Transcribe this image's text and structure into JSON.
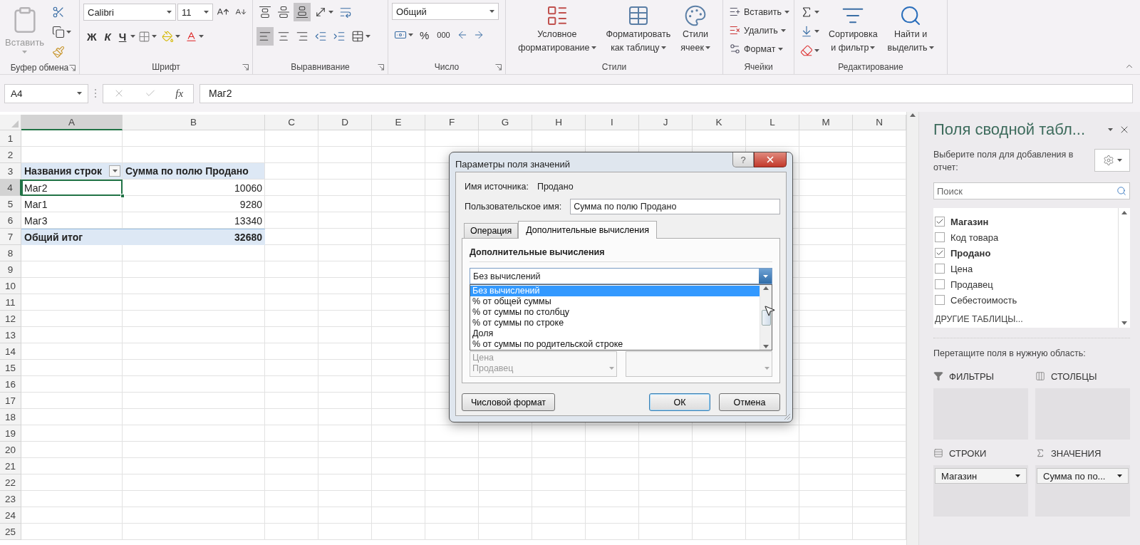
{
  "ribbon": {
    "clipboard": {
      "label": "Буфер обмена",
      "paste": "Вставить"
    },
    "font": {
      "label": "Шрифт",
      "font_name": "Calibri",
      "font_size": "11",
      "bold": "Ж",
      "italic": "К",
      "underline": "Ч"
    },
    "alignment": {
      "label": "Выравнивание",
      "vertical": [
        {
          "selected": false
        },
        {
          "selected": false
        },
        {
          "selected": true
        }
      ],
      "horizontal": [
        {
          "selected": true
        },
        {
          "selected": false
        },
        {
          "selected": false
        }
      ]
    },
    "number": {
      "label": "Число",
      "format": "Общий",
      "percent": "%",
      "thousands": "000"
    },
    "styles": {
      "label": "Стили",
      "buttons": [
        {
          "kind": "conditional",
          "lines": [
            "Условное",
            "форматирование"
          ]
        },
        {
          "kind": "table",
          "lines": [
            "Форматировать",
            "как таблицу"
          ]
        },
        {
          "kind": "cell",
          "lines": [
            "Стили",
            "ячеек"
          ]
        }
      ]
    },
    "cells": {
      "label": "Ячейки",
      "buttons": [
        {
          "kind": "insert",
          "label": "Вставить"
        },
        {
          "kind": "delete",
          "label": "Удалить"
        },
        {
          "kind": "format",
          "label": "Формат"
        }
      ]
    },
    "editing": {
      "label": "Редактирование",
      "buttons": [
        {
          "kind": "sort",
          "lines": [
            "Сортировка",
            "и фильтр"
          ]
        },
        {
          "kind": "find",
          "lines": [
            "Найти и",
            "выделить"
          ]
        }
      ]
    }
  },
  "formula_bar": {
    "name_box": "A4",
    "fx": "fx",
    "value": "Маг2"
  },
  "sheet": {
    "columns": [
      {
        "label": "A",
        "selected": true
      },
      {
        "label": "B",
        "selected": false
      },
      {
        "label": "C",
        "selected": false
      },
      {
        "label": "D",
        "selected": false
      },
      {
        "label": "E",
        "selected": false
      },
      {
        "label": "F",
        "selected": false
      },
      {
        "label": "G",
        "selected": false
      },
      {
        "label": "H",
        "selected": false
      },
      {
        "label": "I",
        "selected": false
      },
      {
        "label": "J",
        "selected": false
      },
      {
        "label": "K",
        "selected": false
      },
      {
        "label": "L",
        "selected": false
      },
      {
        "label": "M",
        "selected": false
      },
      {
        "label": "N",
        "selected": false
      }
    ],
    "rows": [
      {
        "label": "1",
        "selected": false
      },
      {
        "label": "2",
        "selected": false
      },
      {
        "label": "3",
        "selected": false
      },
      {
        "label": "4",
        "selected": true
      },
      {
        "label": "5",
        "selected": false
      },
      {
        "label": "6",
        "selected": false
      },
      {
        "label": "7",
        "selected": false
      },
      {
        "label": "8",
        "selected": false
      },
      {
        "label": "9",
        "selected": false
      },
      {
        "label": "10",
        "selected": false
      },
      {
        "label": "11",
        "selected": false
      },
      {
        "label": "12",
        "selected": false
      },
      {
        "label": "13",
        "selected": false
      },
      {
        "label": "14",
        "selected": false
      },
      {
        "label": "15",
        "selected": false
      },
      {
        "label": "16",
        "selected": false
      },
      {
        "label": "17",
        "selected": false
      },
      {
        "label": "18",
        "selected": false
      },
      {
        "label": "19",
        "selected": false
      },
      {
        "label": "20",
        "selected": false
      },
      {
        "label": "21",
        "selected": false
      },
      {
        "label": "22",
        "selected": false
      },
      {
        "label": "23",
        "selected": false
      },
      {
        "label": "24",
        "selected": false
      },
      {
        "label": "25",
        "selected": false
      }
    ],
    "pivot": {
      "headers": [
        "Названия строк",
        "Сумма по полю Продано"
      ],
      "rows": [
        {
          "label": "Маг2",
          "value": "10060",
          "selected": true
        },
        {
          "label": "Маг1",
          "value": "9280",
          "selected": false
        },
        {
          "label": "Маг3",
          "value": "13340",
          "selected": false
        }
      ],
      "total": {
        "label": "Общий итог",
        "value": "32680"
      }
    }
  },
  "dialog": {
    "title": "Параметры поля значений",
    "help": "?",
    "source_label": "Имя источника:",
    "source_value": "Продано",
    "custom_label": "Пользовательское имя:",
    "custom_value": "Сумма по полю Продано",
    "tabs": [
      {
        "label": "Операция",
        "selected": false
      },
      {
        "label": "Дополнительные вычисления",
        "selected": true
      }
    ],
    "section_title": "Дополнительные вычисления",
    "combo_value": "Без вычислений",
    "options": [
      {
        "label": "Без вычислений",
        "selected": true
      },
      {
        "label": "% от общей суммы",
        "selected": false
      },
      {
        "label": "% от суммы по столбцу",
        "selected": false
      },
      {
        "label": "% от суммы по строке",
        "selected": false
      },
      {
        "label": "Доля",
        "selected": false
      },
      {
        "label": "% от суммы по родительской строке",
        "selected": false
      }
    ],
    "base_field_items": [
      "Цена",
      "Продавец"
    ],
    "buttons": [
      {
        "kind": "secondary",
        "label": "Числовой формат"
      },
      {
        "kind": "default",
        "label": "ОК"
      },
      {
        "kind": "normal",
        "label": "Отмена"
      }
    ]
  },
  "pane": {
    "title": "Поля сводной табл...",
    "subtitle": "Выберите поля для добавления в отчет:",
    "search_placeholder": "Поиск",
    "fields": [
      {
        "label": "Магазин",
        "checked": true
      },
      {
        "label": "Код товара",
        "checked": false
      },
      {
        "label": "Продано",
        "checked": true
      },
      {
        "label": "Цена",
        "checked": false
      },
      {
        "label": "Продавец",
        "checked": false
      },
      {
        "label": "Себестоимость",
        "checked": false
      }
    ],
    "more_tables": "ДРУГИЕ ТАБЛИЦЫ...",
    "drag_hint": "Перетащите поля в нужную область:",
    "areas": [
      {
        "kind": "filters",
        "label": "ФИЛЬТРЫ"
      },
      {
        "kind": "columns",
        "label": "СТОЛБЦЫ"
      },
      {
        "kind": "rows",
        "label": "СТРОКИ",
        "items": [
          "Магазин"
        ]
      },
      {
        "kind": "values",
        "label": "ЗНАЧЕНИЯ",
        "items": [
          "Сумма по по..."
        ]
      }
    ]
  }
}
